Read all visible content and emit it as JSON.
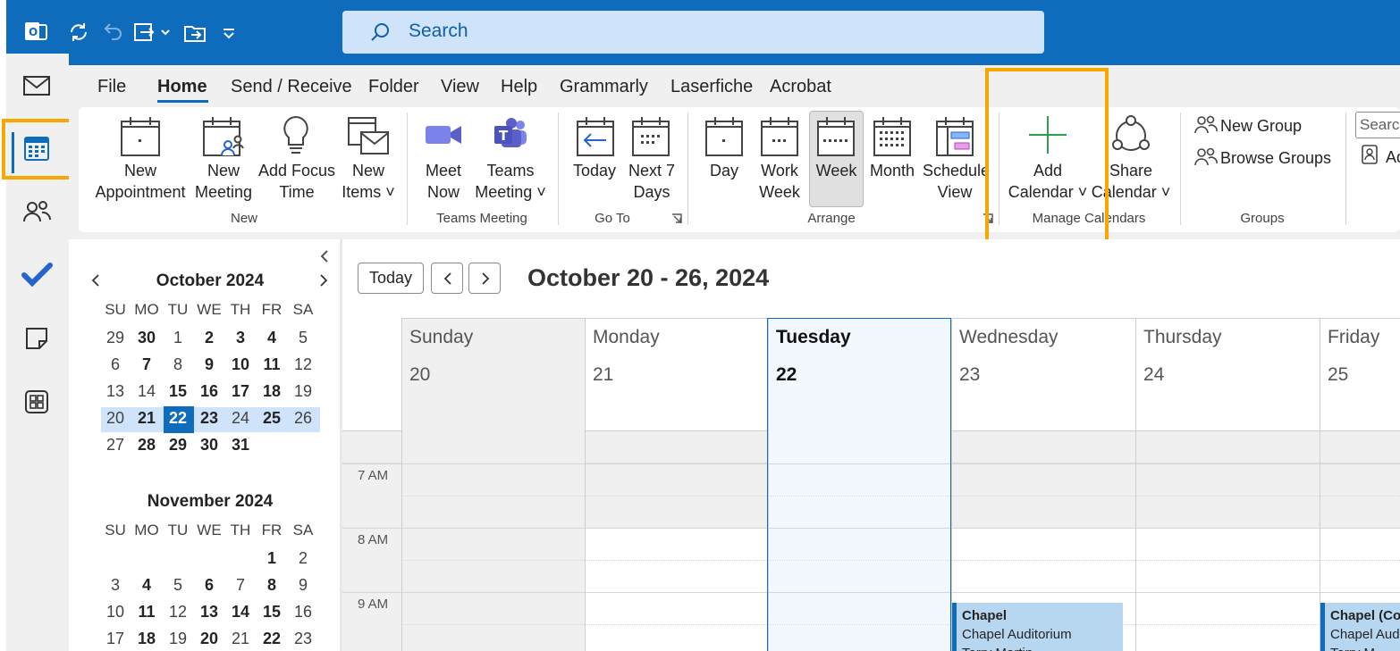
{
  "search": {
    "placeholder": "Search"
  },
  "menu": {
    "items": [
      "File",
      "Home",
      "Send / Receive",
      "Folder",
      "View",
      "Help",
      "Grammarly",
      "Laserfiche",
      "Acrobat"
    ]
  },
  "ribbon": {
    "new_group": {
      "label": "New",
      "new_appointment": "New\nAppointment",
      "new_meeting": "New\nMeeting",
      "add_focus_time": "Add Focus\nTime",
      "new_items": "New\nItems ˅"
    },
    "teams_group": {
      "label": "Teams Meeting",
      "meet_now": "Meet\nNow",
      "teams_meeting": "Teams\nMeeting ˅"
    },
    "goto_group": {
      "label": "Go To",
      "today": "Today",
      "next7": "Next 7\nDays"
    },
    "arrange_group": {
      "label": "Arrange",
      "day": "Day",
      "work_week": "Work\nWeek",
      "week": "Week",
      "month": "Month",
      "schedule_view": "Schedule\nView"
    },
    "manage_group": {
      "label": "Manage Calendars",
      "add_calendar": "Add\nCalendar ˅",
      "share_calendar": "Share\nCalendar ˅"
    },
    "groups_group": {
      "label": "Groups",
      "new_group": "New Group",
      "browse_groups": "Browse Groups"
    },
    "search_people": {
      "placeholder": "Search",
      "address_book": "Ad"
    }
  },
  "mini_calendar": {
    "day_names": [
      "SU",
      "MO",
      "TU",
      "WE",
      "TH",
      "FR",
      "SA"
    ],
    "october": {
      "title": "October 2024",
      "weeks": [
        [
          {
            "d": "29",
            "b": false
          },
          {
            "d": "30",
            "b": true
          },
          {
            "d": "1",
            "b": false
          },
          {
            "d": "2",
            "b": true
          },
          {
            "d": "3",
            "b": true
          },
          {
            "d": "4",
            "b": true
          },
          {
            "d": "5",
            "b": false
          }
        ],
        [
          {
            "d": "6",
            "b": false
          },
          {
            "d": "7",
            "b": true
          },
          {
            "d": "8",
            "b": false
          },
          {
            "d": "9",
            "b": true
          },
          {
            "d": "10",
            "b": true
          },
          {
            "d": "11",
            "b": true
          },
          {
            "d": "12",
            "b": false
          }
        ],
        [
          {
            "d": "13",
            "b": false
          },
          {
            "d": "14",
            "b": false
          },
          {
            "d": "15",
            "b": true
          },
          {
            "d": "16",
            "b": true
          },
          {
            "d": "17",
            "b": true
          },
          {
            "d": "18",
            "b": true
          },
          {
            "d": "19",
            "b": false
          }
        ],
        [
          {
            "d": "20",
            "b": false
          },
          {
            "d": "21",
            "b": true
          },
          {
            "d": "22",
            "b": true
          },
          {
            "d": "23",
            "b": true
          },
          {
            "d": "24",
            "b": false
          },
          {
            "d": "25",
            "b": true
          },
          {
            "d": "26",
            "b": false
          }
        ],
        [
          {
            "d": "27",
            "b": false
          },
          {
            "d": "28",
            "b": true
          },
          {
            "d": "29",
            "b": true
          },
          {
            "d": "30",
            "b": true
          },
          {
            "d": "31",
            "b": true
          }
        ]
      ]
    },
    "november": {
      "title": "November 2024",
      "weeks": [
        [
          {
            "d": "",
            "b": false
          },
          {
            "d": "",
            "b": false
          },
          {
            "d": "",
            "b": false
          },
          {
            "d": "",
            "b": false
          },
          {
            "d": "",
            "b": false
          },
          {
            "d": "1",
            "b": true
          },
          {
            "d": "2",
            "b": false
          }
        ],
        [
          {
            "d": "3",
            "b": false
          },
          {
            "d": "4",
            "b": true
          },
          {
            "d": "5",
            "b": false
          },
          {
            "d": "6",
            "b": true
          },
          {
            "d": "7",
            "b": false
          },
          {
            "d": "8",
            "b": true
          },
          {
            "d": "9",
            "b": false
          }
        ],
        [
          {
            "d": "10",
            "b": false
          },
          {
            "d": "11",
            "b": true
          },
          {
            "d": "12",
            "b": false
          },
          {
            "d": "13",
            "b": true
          },
          {
            "d": "14",
            "b": true
          },
          {
            "d": "15",
            "b": true
          },
          {
            "d": "16",
            "b": false
          }
        ],
        [
          {
            "d": "17",
            "b": false
          },
          {
            "d": "18",
            "b": true
          },
          {
            "d": "19",
            "b": false
          },
          {
            "d": "20",
            "b": true
          },
          {
            "d": "21",
            "b": false
          },
          {
            "d": "22",
            "b": true
          },
          {
            "d": "23",
            "b": false
          }
        ]
      ]
    },
    "selected_day": "22"
  },
  "calendar": {
    "today_button": "Today",
    "range_title": "October 20 - 26, 2024",
    "days": [
      {
        "name": "Sunday",
        "num": "20"
      },
      {
        "name": "Monday",
        "num": "21"
      },
      {
        "name": "Tuesday",
        "num": "22"
      },
      {
        "name": "Wednesday",
        "num": "23"
      },
      {
        "name": "Thursday",
        "num": "24"
      },
      {
        "name": "Friday",
        "num": "25"
      }
    ],
    "times": [
      "7 AM",
      "8 AM",
      "9 AM"
    ],
    "events": [
      {
        "title": "Chapel",
        "location": "Chapel Auditorium",
        "organizer": "Terry Martin"
      },
      {
        "title": "Chapel (Co",
        "location": "Chapel Aud",
        "organizer": "Terry M"
      }
    ]
  },
  "colors": {
    "accent": "#0f6cbd",
    "highlight": "#f7a700",
    "event_fill": "#b7d7f0"
  }
}
